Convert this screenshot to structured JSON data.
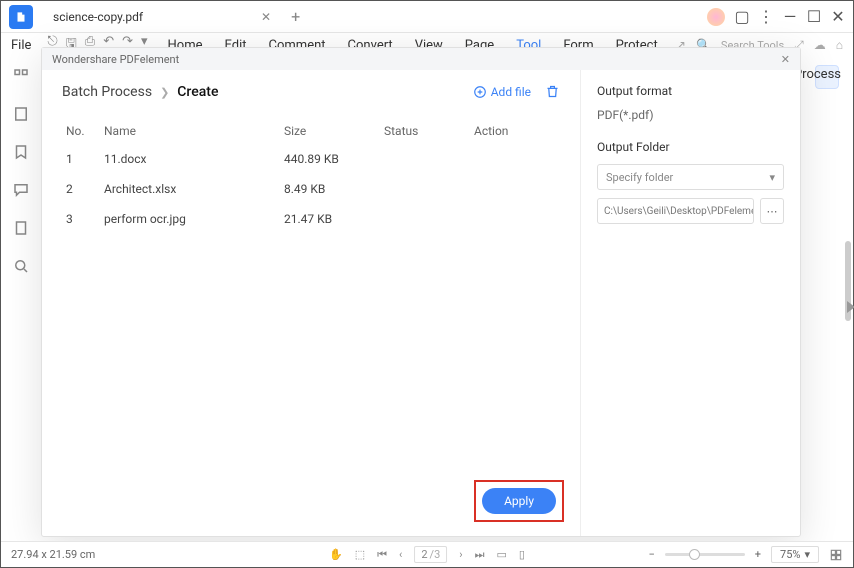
{
  "titlebar": {
    "tab_name": "science-copy.pdf"
  },
  "menubar": {
    "file": "File",
    "items": [
      "Home",
      "Edit",
      "Comment",
      "Convert",
      "View",
      "Page",
      "Tool",
      "Form",
      "Protect"
    ],
    "search_placeholder": "Search Tools"
  },
  "sub": {
    "process": "Process"
  },
  "modal": {
    "title": "Wondershare PDFelement",
    "breadcrumb": {
      "bc1": "Batch Process",
      "bc2": "Create"
    },
    "addfile": "Add file",
    "columns": {
      "no": "No.",
      "name": "Name",
      "size": "Size",
      "status": "Status",
      "action": "Action"
    },
    "rows": [
      {
        "no": "1",
        "name": "11.docx",
        "size": "440.89 KB"
      },
      {
        "no": "2",
        "name": "Architect.xlsx",
        "size": "8.49 KB"
      },
      {
        "no": "3",
        "name": "perform ocr.jpg",
        "size": "21.47 KB"
      }
    ],
    "right": {
      "output_format_label": "Output format",
      "output_format_value": "PDF(*.pdf)",
      "output_folder_label": "Output Folder",
      "specify_folder": "Specify folder",
      "path": "C:\\Users\\Geili\\Desktop\\PDFelement\\Cr"
    },
    "apply": "Apply"
  },
  "statusbar": {
    "dims": "27.94 x 21.59 cm",
    "page_current": "2",
    "page_total": "/3",
    "zoom": "75%"
  }
}
